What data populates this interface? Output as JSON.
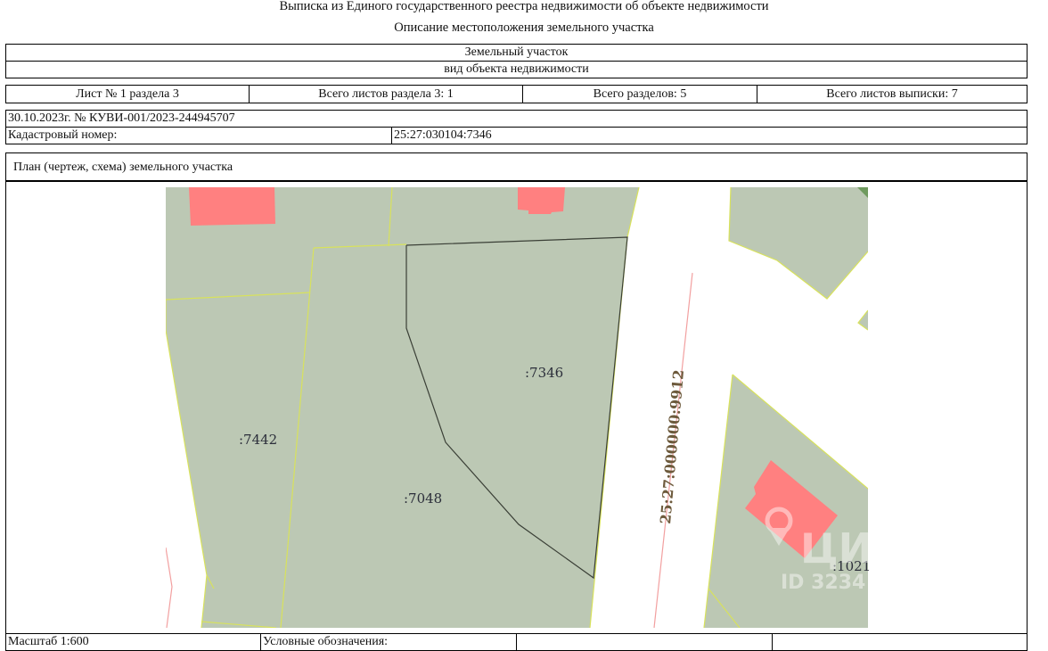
{
  "header": {
    "title": "Выписка из Единого государственного реестра недвижимости об объекте недвижимости",
    "subtitle": "Описание местоположения земельного участка"
  },
  "object": {
    "type": "Земельный участок",
    "type_caption": "вид объекта недвижимости"
  },
  "sheet_info": {
    "sheet": "Лист № 1 раздела 3",
    "total_section_sheets": "Всего листов раздела 3: 1",
    "total_sections": "Всего разделов: 5",
    "total_sheets": "Всего листов выписки: 7"
  },
  "record": {
    "date_number": "30.10.2023г. № КУВИ-001/2023-244945707",
    "cadastral_label": "Кадастровый номер:",
    "cadastral_value": "25:27:030104:7346"
  },
  "plan": {
    "heading": "План (чертеж, схема) земельного участка",
    "labels": {
      "parcel_main": ":7346",
      "parcel_left": ":7442",
      "parcel_mid": ":7048",
      "parcel_right": ":1021",
      "road": "25:27:000000:9912"
    },
    "colors": {
      "parcel_fill": "#bcc8b4",
      "building_fill": "#ff8080",
      "boundary": "#d8e25c",
      "selected_outline": "#3a3f36",
      "road_line": "#f2a0a0"
    }
  },
  "watermark": {
    "brand": "ЦИАН",
    "id_text": "ID 3234"
  },
  "footer": {
    "scale": "Масштаб 1:600",
    "legend": "Условные обозначения:"
  }
}
